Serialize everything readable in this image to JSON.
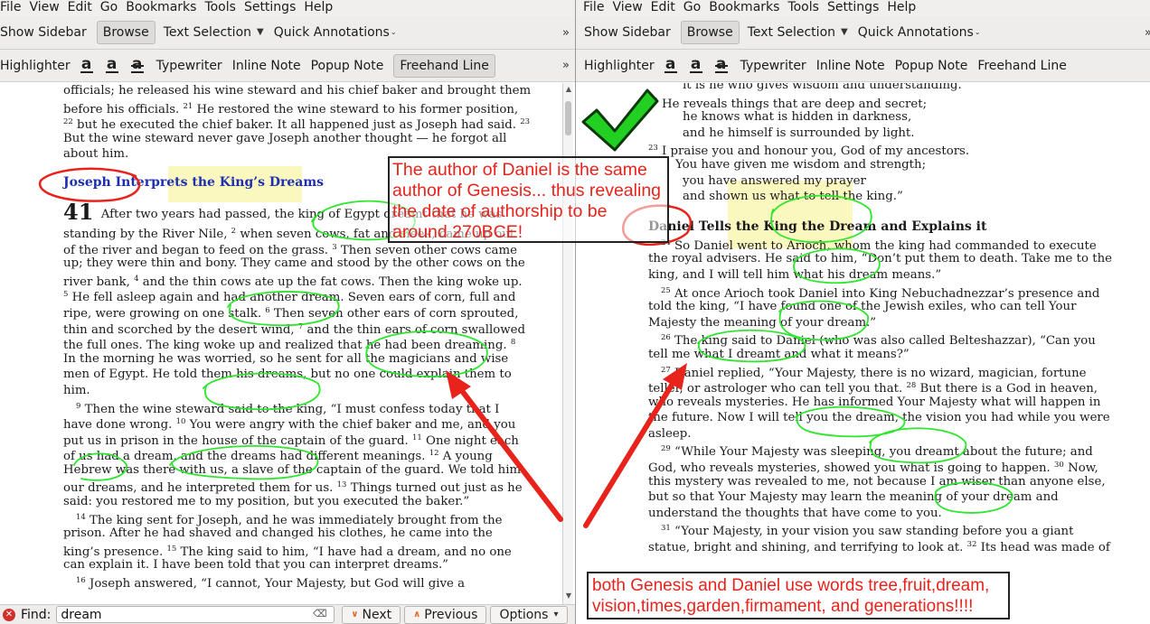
{
  "menu": [
    "File",
    "View",
    "Edit",
    "Go",
    "Bookmarks",
    "Tools",
    "Settings",
    "Help"
  ],
  "toolbar1": {
    "show_sidebar": "Show Sidebar",
    "browse": "Browse",
    "text_selection": "Text Selection",
    "quick_annotations": "Quick Annotations"
  },
  "toolbar2": {
    "highlighter": "Highlighter",
    "typewriter": "Typewriter",
    "inline_note": "Inline Note",
    "popup_note": "Popup Note",
    "freehand_line": "Freehand Line"
  },
  "left_doc": {
    "lines": [
      "officials; he released his wine steward and his chief baker and brought them",
      "before his officials. <sup>21</sup> He restored the wine steward to his former position,",
      "<sup>22</sup> but he executed the chief baker. It all happened just as Joseph had said. <sup>23</sup>",
      "But the wine steward never gave Joseph another thought — he forgot all",
      "about him."
    ],
    "heading": "Joseph Interprets the King’s Dreams",
    "chapter": "41",
    "body": [
      "After two years had passed, the king of Egypt dreamt that he was",
      "standing by the River Nile, <sup>2</sup> when seven cows, fat and sleek, came up out",
      "of the river and began to feed on the grass. <sup>3</sup> Then seven other cows came",
      "up; they were thin and bony. They came and stood by the other cows on the",
      "river bank, <sup>4</sup> and the thin cows ate up the fat cows. Then the king woke up.",
      "<sup>5</sup> He fell asleep again and had another dream. Seven ears of corn, full and",
      "ripe, were growing on one stalk. <sup>6</sup> Then seven other ears of corn sprouted,",
      "thin and scorched by the desert wind, <sup>7</sup> and the thin ears of corn swallowed",
      "the full ones. The king woke up and realized that he had been dreaming. <sup>8</sup>",
      "In the morning he was worried, so he sent for all the magicians and wise",
      "men of Egypt. He told them his dreams, but no one could explain them to",
      "him.",
      "IND<sup>9</sup> Then the wine steward said to the king, “I must confess today that I",
      "have done wrong. <sup>10</sup> You were angry with the chief baker and me, and you",
      "put us in prison in the house of the captain of the guard. <sup>11</sup> One night each",
      "of us had a dream, and the dreams had different meanings. <sup>12</sup> A young",
      "Hebrew was there with us, a slave of the captain of the guard. We told him",
      "our dreams, and he interpreted them for us. <sup>13</sup> Things turned out just as he",
      "said: you restored me to my position, but you executed the baker.”",
      "IND<sup>14</sup> The king sent for Joseph, and he was immediately brought from the",
      "prison. After he had shaved and changed his clothes, he came into the",
      "king’s presence. <sup>15</sup> The king said to him, “I have had a dream, and no one",
      "can explain it. I have been told that you can interpret dreams.”",
      "IND<sup>16</sup> Joseph answered, “I cannot, Your Majesty, but God will give a"
    ]
  },
  "right_doc": {
    "lines": [
      "IN2it is he who gives wisdom and understanding.",
      "<sup>22</sup> He reveals things that are deep and secret;",
      "IN2he knows what is hidden in darkness,",
      "IN2and he himself is surrounded by light.",
      "<sup>23</sup> I praise you and honour you, God of my ancestors.",
      "IN1You have given me wisdom and strength;",
      "IN2you have answered my prayer",
      "IN2and shown us what to tell the king.”"
    ],
    "heading": "Daniel Tells the King the Dream and Explains it",
    "body": [
      "IND<sup>24</sup> So Daniel went to Arioch, whom the king had commanded to execute",
      "the royal advisers. He said to him, “Don’t put them to death. Take me to the",
      "king, and I will tell him what his dream means.”",
      "IND<sup>25</sup> At once Arioch took Daniel into King Nebuchadnezzar’s presence and",
      "told the king, “I have found one of the Jewish exiles, who can tell Your",
      "Majesty the meaning of your dream.”",
      "IND<sup>26</sup> The king said to Daniel (who was also called Belteshazzar), “Can you",
      "tell me what I dreamt and what it means?”",
      "IND<sup>27</sup> Daniel replied, “Your Majesty, there is no wizard, magician, fortune",
      "teller, or astrologer who can tell you that. <sup>28</sup> But there is a God in heaven,",
      "who reveals mysteries. He has informed Your Majesty what will happen in",
      "the future. Now I will tell you the dream, the vision you had while you were",
      "asleep.",
      "IND<sup>29</sup> “While Your Majesty was sleeping, you dreamt about the future; and",
      "God, who reveals mysteries, showed you what is going to happen. <sup>30</sup> Now,",
      "this mystery was revealed to me, not because I am wiser than anyone else,",
      "but so that Your Majesty may learn the meaning of your dream and",
      "understand the thoughts that have come to you.",
      "IND<sup>31</sup> “Your Majesty, in your vision you saw standing before you a giant",
      "statue, bright and shining, and terrifying to look at. <sup>32</sup> Its head was made of"
    ]
  },
  "find": {
    "label": "Find:",
    "value": "dream",
    "next": "Next",
    "previous": "Previous",
    "options": "Options"
  },
  "notes": {
    "author": "The author of Daniel is the same author of Genesis... thus revealing the date of authorship to be around 270BCE!",
    "words": "both Genesis and Daniel use words tree,fruit,dream, vision,times,garden,firmament, and generations!!!!"
  },
  "colors": {
    "annotation_red": "#e8231c",
    "annotation_green": "#2ee62e",
    "heading_blue": "#1d2fb0",
    "highlight_yellow": "#faf5aa"
  }
}
